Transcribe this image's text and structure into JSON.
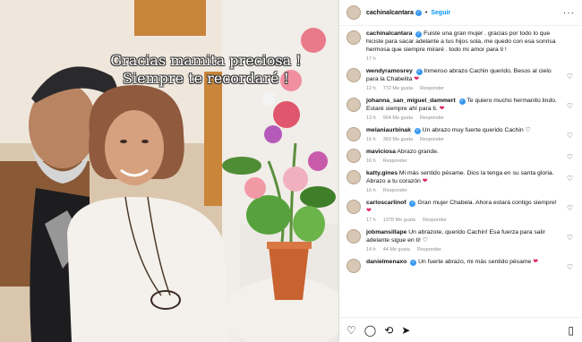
{
  "post": {
    "overlay_line1": "Gracias mamita preciosa !",
    "overlay_line2": "Siempre te recordaré !"
  },
  "header": {
    "username": "cachinalcantara",
    "follow_label": "Seguir",
    "more_icon": "more-options-icon"
  },
  "caption": {
    "username": "cachinalcantara",
    "text": "Fuiste una gran mujer . gracias por todo lo que hiciste para sacar adelante a tus hijos sola, me quedo con esa sonrisa hermosa que siempre miraré . todo mi amor para ti !",
    "time": "17 h"
  },
  "comments": [
    {
      "username": "wendyramosrey",
      "text": "Inmenso abrazo Cachin querido, Besos al cielo para la Chabelita",
      "emoji": "❤",
      "time": "12 h",
      "likes": "772 Me gusta",
      "reply": "Responder"
    },
    {
      "username": "johanna_san_miguel_dammert",
      "text": "Te quiero mucho hermanito lindo. Estaré siempre ahí para ti.",
      "emoji": "❤",
      "time": "13 h",
      "likes": "904 Me gusta",
      "reply": "Responder"
    },
    {
      "username": "melaniaurbinak",
      "text": "Un abrazo muy fuerte querido Cachin",
      "emoji": "♡",
      "time": "16 h",
      "likes": "369 Me gusta",
      "reply": "Responder"
    },
    {
      "username": "maviciosa",
      "text": "Abrazo grande.",
      "emoji": "",
      "time": "16 h",
      "likes": "",
      "reply": "Responder"
    },
    {
      "username": "katty.gines",
      "text": "Mi más sentido pésame. Dios la tenga en su santa gloria. Abrazo a tu corazón",
      "emoji": "❤",
      "time": "16 h",
      "likes": "",
      "reply": "Responder"
    },
    {
      "username": "carloscarlinof",
      "text": "Gran mujer Chabela. Ahora estará contigo siempre!",
      "emoji": "❤",
      "time": "17 h",
      "likes": "1378 Me gusta",
      "reply": "Responder"
    },
    {
      "username": "jobmansillape",
      "text": "Un abrazote, querido Cachin! Esa fuerza para salir adelante sigue en ti!",
      "emoji": "♡",
      "time": "14 h",
      "likes": "44 Me gusta",
      "reply": "Responder"
    },
    {
      "username": "danielmenaxo",
      "text": "Un fuerte abrazo, mi más sentido pésame",
      "emoji": "❤",
      "time": "",
      "likes": "",
      "reply": ""
    }
  ],
  "actions": {
    "like_icon": "heart-icon",
    "comment_icon": "comment-icon",
    "repost_icon": "repost-icon",
    "share_icon": "share-icon",
    "save_icon": "bookmark-icon"
  },
  "colors": {
    "accent": "#0095f6",
    "verified": "#3897f0",
    "heart_red": "#e0245e"
  }
}
